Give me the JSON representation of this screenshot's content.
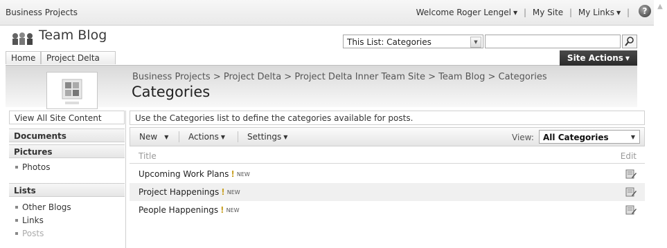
{
  "topbar": {
    "site_name": "Business Projects",
    "welcome": "Welcome Roger Lengel",
    "my_site": "My Site",
    "my_links": "My Links",
    "help_glyph": "?"
  },
  "header": {
    "title": "Team Blog",
    "search_scope": "This List: Categories",
    "search_value": ""
  },
  "nav": {
    "tabs": [
      "Home",
      "Project Delta"
    ],
    "site_actions": "Site Actions"
  },
  "page": {
    "breadcrumb": "Business Projects > Project Delta > Project Delta Inner Team Site > Team Blog > Categories",
    "title": "Categories",
    "description": "Use the Categories list to define the categories available for posts."
  },
  "leftnav": {
    "view_all": "View All Site Content",
    "documents": "Documents",
    "pictures": "Pictures",
    "pictures_items": [
      "Photos"
    ],
    "lists": "Lists",
    "lists_items": [
      "Other Blogs",
      "Links",
      "Posts"
    ]
  },
  "toolbar": {
    "new": "New",
    "actions": "Actions",
    "settings": "Settings",
    "view_label": "View:",
    "view_value": "All Categories"
  },
  "list": {
    "col_title": "Title",
    "col_edit": "Edit",
    "new_badge": "NEW",
    "rows": [
      {
        "title": "Upcoming Work Plans"
      },
      {
        "title": "Project Happenings"
      },
      {
        "title": "People Happenings"
      }
    ]
  },
  "colors": {
    "site_actions_bg": "#333333",
    "new_marker": "#c9a227"
  },
  "icons": [
    "team-blog-icon",
    "help-icon",
    "search-icon",
    "dropdown-arrow-icon",
    "site-logo",
    "edit-item-icon"
  ]
}
